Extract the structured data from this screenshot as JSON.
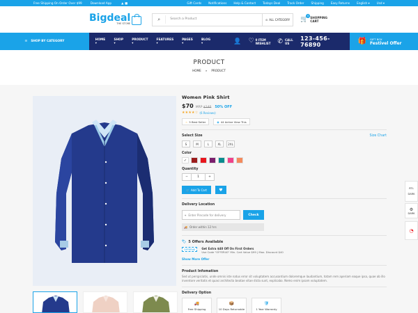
{
  "topbar": {
    "shipping": "Free Shipping On Order Over $99",
    "download": "Download App",
    "links": [
      "Gift Cards",
      "Notifications",
      "Help & Contact",
      "Todays Deal",
      "Track Order",
      "Shipping",
      "Easy Returns",
      "English",
      "Usd"
    ]
  },
  "header": {
    "logo": "Bigdeal",
    "logo_sub": "THE STORE",
    "search_placeholder": "Search a Product",
    "category_label": "ALL CATEGORY",
    "cart_count": "0",
    "cart_label_1": "SHOPPING",
    "cart_label_2": "CART"
  },
  "nav": {
    "shop_by_category": "SHOP BY CATEGORY",
    "menu": [
      "HOME",
      "SHOP",
      "PRODUCT",
      "FEATURES",
      "PAGES",
      "BLOG"
    ],
    "wishlist_count": "0",
    "wishlist_1": "0 ITEM",
    "wishlist_2": "WISHLIST",
    "call_label": "CALL US",
    "phone": "123-456-76890",
    "gift_1": "GIFT BOX",
    "gift_2": "Festivel Offer"
  },
  "page": {
    "title": "PRODUCT",
    "crumb_home": "HOME",
    "crumb_sep": "»",
    "crumb_current": "PRODUCT"
  },
  "product": {
    "name": "Women Pink Shirt",
    "price": "$70",
    "mrp_label": "MRP",
    "mrp": "$140",
    "discount": "50% OFF",
    "stars": "★★★★☆",
    "rating_value": 4,
    "reviews": "(6 Reviews)",
    "tag_1": "5 Best Seller",
    "tag_2": "44 Active View This",
    "select_size": "Select Size",
    "size_chart": "Size Chart",
    "sizes": [
      "S",
      "M",
      "L",
      "XL",
      "2XL"
    ],
    "color_label": "Color",
    "colors": [
      "#ffffff",
      "#9b1c1c",
      "#e8161d",
      "#7b1f6d",
      "#0a8c8f",
      "#f0428a",
      "#f48a5c"
    ],
    "quantity_label": "Quantity",
    "qty_minus": "−",
    "qty_value": "1",
    "qty_plus": "+",
    "add_to_cart": "Add To Cart",
    "delivery_location": "Delivery Location",
    "pincode_placeholder": "Enter Pincode for delivery",
    "check": "Check",
    "order_within": "Order within 12 hrs",
    "offers_title": "5 Offers Available",
    "offer_code": "OFFER40",
    "offer_line_1": "Get Extra $40 Off On First Orders",
    "offer_line_2": "Use Code \"OFFER40\" Min. Cart Value $99 | Max. Discount $40",
    "show_more": "Show More Offer",
    "info_title": "Product Infomation",
    "info_text": "Sed ut perspiciatis, unde omnis iste natus error sit voluptatem accusantium doloremque laudantium, totam rem aperiam eaque ipsa, quae ab illo inventore veritatis et quasi architecto beatae vitae dicta sunt, explicabo. Nemo enim ipsam voluptatem.",
    "delivery_option": "Delivery Option",
    "services": [
      "Free Shipping",
      "10 Days Returnable",
      "1 Year Warranty"
    ]
  },
  "side": {
    "rtl": "RTL",
    "dark": "DARK",
    "dark2": "DARK"
  }
}
